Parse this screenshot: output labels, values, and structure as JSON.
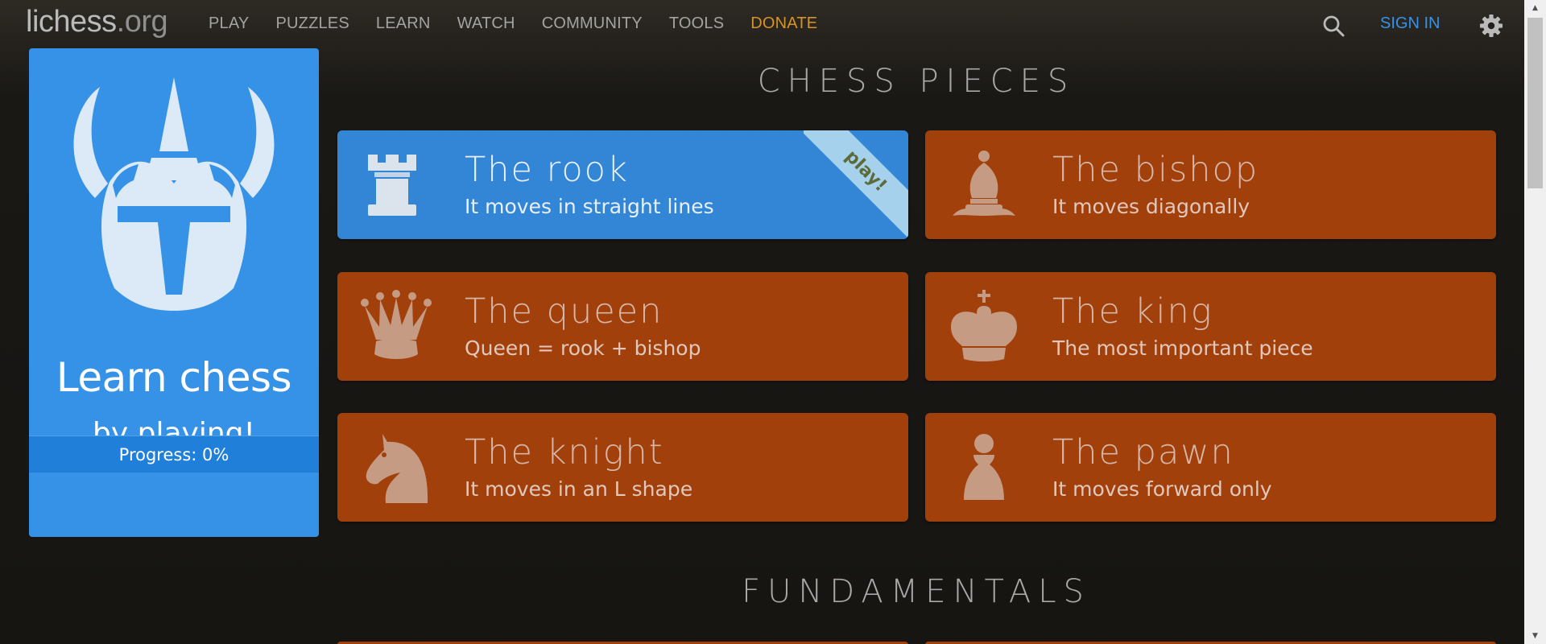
{
  "header": {
    "logo_name": "lichess",
    "logo_tld": ".org",
    "nav": [
      "PLAY",
      "PUZZLES",
      "LEARN",
      "WATCH",
      "COMMUNITY",
      "TOOLS",
      "DONATE"
    ],
    "signin": "SIGN IN"
  },
  "side": {
    "title": "Learn chess",
    "subtitle": "by playing!",
    "progress": "Progress: 0%"
  },
  "sections": {
    "chess_pieces": "CHESS PIECES",
    "fundamentals": "FUNDAMENTALS"
  },
  "stages": [
    {
      "name": "The rook",
      "desc": "It moves in straight lines",
      "icon": "rook-icon",
      "active": true,
      "ribbon": "play!"
    },
    {
      "name": "The bishop",
      "desc": "It moves diagonally",
      "icon": "bishop-icon"
    },
    {
      "name": "The queen",
      "desc": "Queen = rook + bishop",
      "icon": "queen-icon"
    },
    {
      "name": "The king",
      "desc": "The most important piece",
      "icon": "king-icon"
    },
    {
      "name": "The knight",
      "desc": "It moves in an L shape",
      "icon": "knight-icon"
    },
    {
      "name": "The pawn",
      "desc": "It moves forward only",
      "icon": "pawn-icon"
    }
  ],
  "colors": {
    "accent_blue": "#3692e7",
    "stage_orange": "#a2400c",
    "donate": "#d69327"
  }
}
